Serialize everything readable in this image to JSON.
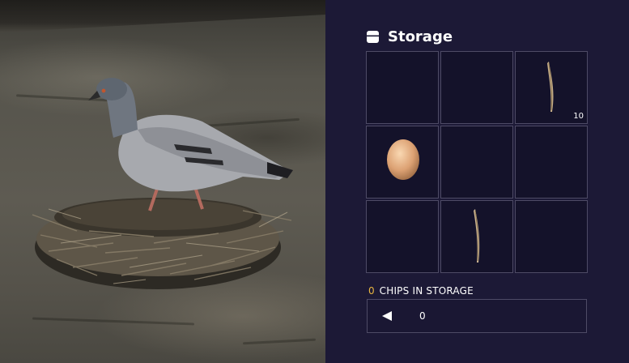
{
  "storage": {
    "title": "Storage",
    "title_icon": "storage-box-icon",
    "slots": [
      {
        "item": null,
        "count": ""
      },
      {
        "item": null,
        "count": ""
      },
      {
        "item": "twig-icon",
        "count": "10"
      },
      {
        "item": "egg-icon",
        "count": ""
      },
      {
        "item": null,
        "count": ""
      },
      {
        "item": null,
        "count": ""
      },
      {
        "item": null,
        "count": ""
      },
      {
        "item": "twig-icon",
        "count": ""
      },
      {
        "item": null,
        "count": ""
      }
    ]
  },
  "chips": {
    "count": "0",
    "label": "CHIPS IN STORAGE",
    "input_value": "0",
    "arrow_icon": "left-arrow-icon"
  },
  "colors": {
    "panel_bg": "#1c1936",
    "slot_bg": "#14122a",
    "slot_border": "#4e4b66",
    "chip_count": "#e9b640"
  }
}
